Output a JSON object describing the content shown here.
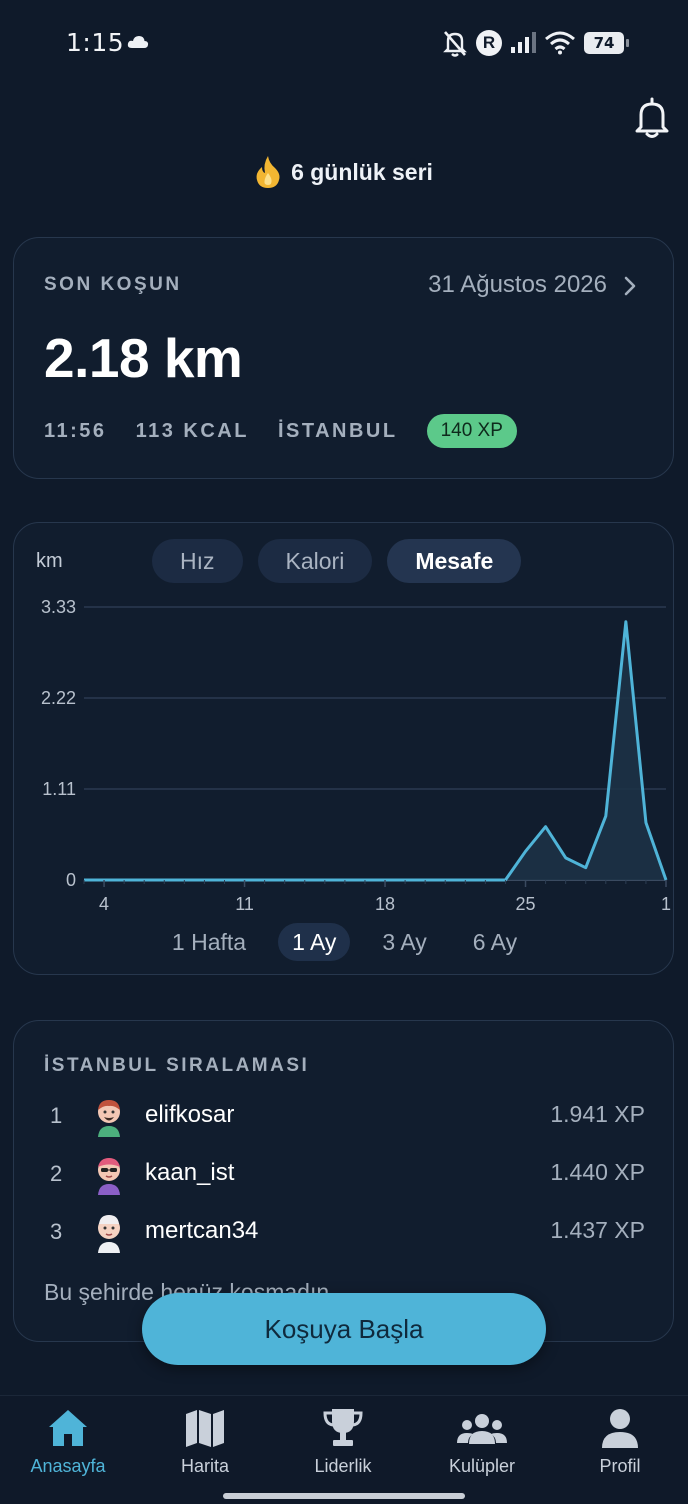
{
  "status_bar": {
    "time": "1:15",
    "battery": "74",
    "roaming_badge": "R",
    "icons": [
      "cloud-icon",
      "bell-off-icon",
      "roaming-icon",
      "signal-icon",
      "wifi-icon",
      "battery-icon"
    ]
  },
  "header": {
    "streak_text": "6 günlük seri",
    "streak_icon": "flame-icon",
    "notification_icon": "bell-icon"
  },
  "last_run": {
    "label": "SON KOŞUN",
    "date": "31 Ağustos 2026",
    "distance": "2.18 km",
    "duration": "11:56",
    "calories": "113 KCAL",
    "city": "İSTANBUL",
    "xp": "140 XP"
  },
  "chart_card": {
    "unit": "km",
    "metric_tabs": [
      "Hız",
      "Kalori",
      "Mesafe"
    ],
    "active_metric": "Mesafe",
    "range_tabs": [
      "1 Hafta",
      "1 Ay",
      "3 Ay",
      "6 Ay"
    ],
    "active_range": "1 Ay"
  },
  "chart_data": {
    "type": "area",
    "ylabel": "km",
    "ylim": [
      0,
      3.33
    ],
    "yticks": [
      "3.33",
      "2.22",
      "1.11",
      "0"
    ],
    "xticks": [
      "4",
      "11",
      "18",
      "25",
      "1"
    ],
    "grid": true,
    "series_color": "#4fb4d8",
    "x": [
      "3",
      "4",
      "5",
      "6",
      "7",
      "8",
      "9",
      "10",
      "11",
      "12",
      "13",
      "14",
      "15",
      "16",
      "17",
      "18",
      "19",
      "20",
      "21",
      "22",
      "23",
      "24",
      "25",
      "26",
      "27",
      "28",
      "29",
      "30",
      "31",
      "1"
    ],
    "values": [
      0,
      0,
      0,
      0,
      0,
      0,
      0,
      0,
      0,
      0,
      0,
      0,
      0,
      0,
      0,
      0,
      0,
      0,
      0,
      0,
      0,
      0,
      0.35,
      0.65,
      0.27,
      0.15,
      0.78,
      3.15,
      0.7,
      0
    ]
  },
  "leaderboard": {
    "title": "İSTANBUL SIRALAMASI",
    "rows": [
      {
        "rank": "1",
        "name": "elifkosar",
        "xp": "1.941 XP"
      },
      {
        "rank": "2",
        "name": "kaan_ist",
        "xp": "1.440 XP"
      },
      {
        "rank": "3",
        "name": "mertcan34",
        "xp": "1.437 XP"
      }
    ],
    "note": "Bu şehirde henüz koşmadın"
  },
  "start_button": "Koşuya Başla",
  "nav": {
    "active": "Anasayfa",
    "items": [
      {
        "label": "Anasayfa",
        "icon": "home-icon"
      },
      {
        "label": "Harita",
        "icon": "map-icon"
      },
      {
        "label": "Liderlik",
        "icon": "trophy-icon"
      },
      {
        "label": "Kulüpler",
        "icon": "group-icon"
      },
      {
        "label": "Profil",
        "icon": "profile-icon"
      }
    ]
  },
  "colors": {
    "background": "#0f1a2a",
    "accent": "#4fb4d8",
    "xp_badge": "#5cc98a"
  }
}
